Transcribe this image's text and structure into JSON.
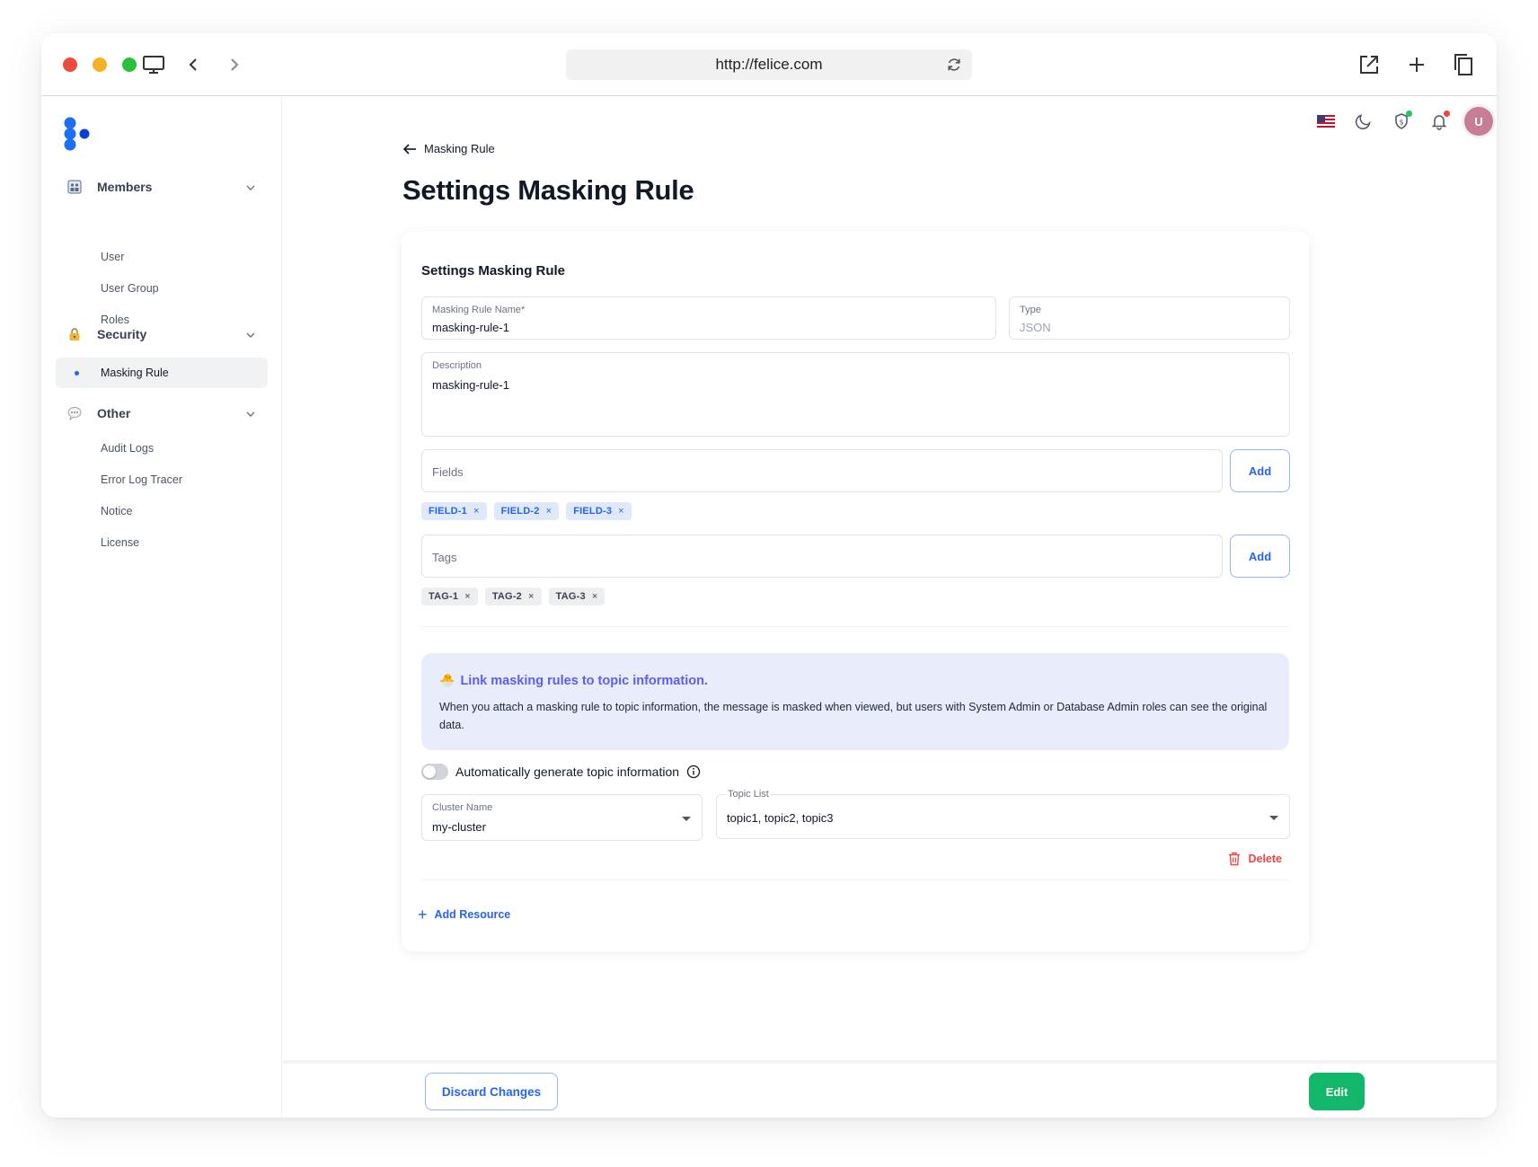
{
  "browser": {
    "url": "http://felice.com"
  },
  "sidebar": {
    "sections": [
      {
        "label": "Members",
        "icon": "members-icon",
        "items": [
          "User",
          "User Group",
          "Roles"
        ]
      },
      {
        "label": "Security",
        "icon": "lock-icon",
        "items": [
          "Masking Rule"
        ]
      },
      {
        "label": "Other",
        "icon": "speech-bubble-icon",
        "items": [
          "Audit Logs",
          "Error Log Tracer",
          "Notice",
          "License"
        ]
      }
    ],
    "active_item": "Masking Rule"
  },
  "header": {
    "avatar_initial": "U",
    "icons": [
      "us-flag-icon",
      "moon-icon",
      "shield-icon",
      "bell-icon"
    ]
  },
  "breadcrumb": {
    "back_label": "Masking Rule"
  },
  "page": {
    "title": "Settings Masking Rule"
  },
  "form": {
    "card_title": "Settings Masking Rule",
    "name": {
      "label": "Masking Rule Name*",
      "value": "masking-rule-1"
    },
    "type": {
      "label": "Type",
      "value": "JSON"
    },
    "description": {
      "label": "Description",
      "value": "masking-rule-1"
    },
    "fields": {
      "placeholder": "Fields",
      "add_label": "Add",
      "chips": [
        "FIELD-1",
        "FIELD-2",
        "FIELD-3"
      ]
    },
    "tags": {
      "placeholder": "Tags",
      "add_label": "Add",
      "chips": [
        "TAG-1",
        "TAG-2",
        "TAG-3"
      ]
    },
    "chip_remove_glyph": "×",
    "info": {
      "emoji": "🐣",
      "title": "Link masking rules to topic information.",
      "body": "When you attach a masking rule to topic information, the message is masked when viewed, but users with System Admin or Database Admin roles can see the original data."
    },
    "auto_generate": {
      "label": "Automatically generate topic information",
      "enabled": false
    },
    "cluster": {
      "label": "Cluster Name",
      "value": "my-cluster"
    },
    "topic_list": {
      "label": "Topic List",
      "value": "topic1, topic2, topic3"
    },
    "delete_label": "Delete",
    "add_resource_label": "Add Resource"
  },
  "footer": {
    "discard_label": "Discard Changes",
    "edit_label": "Edit"
  },
  "colors": {
    "accent": "#2563eb",
    "success": "#12b76a",
    "danger": "#ef4444",
    "info_bg": "#e9ecfb",
    "info_title": "#5b5ff0",
    "avatar": "#c77d93"
  }
}
